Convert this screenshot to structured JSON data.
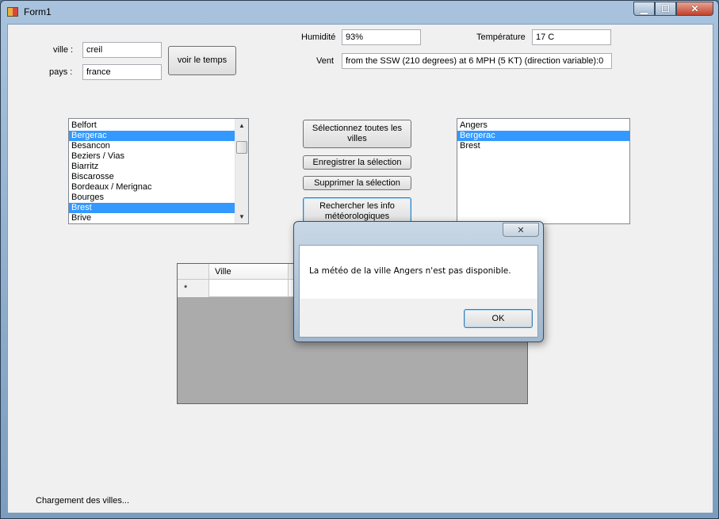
{
  "window": {
    "title": "Form1"
  },
  "form": {
    "ville_label": "ville :",
    "ville_value": "creil",
    "pays_label": "pays :",
    "pays_value": "france",
    "voir_button": "voir le temps",
    "humidite_label": "Humidité",
    "humidite_value": "93%",
    "temperature_label": "Température",
    "temperature_value": "17 C",
    "vent_label": "Vent",
    "vent_value": "from the SSW (210 degrees) at 6 MPH (5 KT) (direction variable):0"
  },
  "city_list": {
    "items": [
      {
        "label": "Belfort",
        "selected": false
      },
      {
        "label": "Bergerac",
        "selected": true
      },
      {
        "label": "Besancon",
        "selected": false
      },
      {
        "label": "Beziers / Vias",
        "selected": false
      },
      {
        "label": "Biarritz",
        "selected": false
      },
      {
        "label": "Biscarosse",
        "selected": false
      },
      {
        "label": "Bordeaux / Merignac",
        "selected": false
      },
      {
        "label": "Bourges",
        "selected": false
      },
      {
        "label": "Brest",
        "selected": true
      },
      {
        "label": "Brive",
        "selected": false
      }
    ]
  },
  "actions": {
    "select_all": "Sélectionnez toutes les villes",
    "save": "Enregistrer la sélection",
    "delete": "Supprimer la sélection",
    "search": "Rechercher les info météorologiques"
  },
  "selected_list": {
    "items": [
      {
        "label": "Angers",
        "selected": false
      },
      {
        "label": "Bergerac",
        "selected": true
      },
      {
        "label": "Brest",
        "selected": false
      }
    ]
  },
  "grid": {
    "column": "Ville",
    "new_row_marker": "*"
  },
  "dialog": {
    "message": "La météo de la ville Angers n'est pas disponible.",
    "ok": "OK"
  },
  "status": {
    "text": "Chargement des villes..."
  },
  "colors": {
    "selection": "#3399ff",
    "client_bg": "#f0f0f0",
    "grid_bg": "#ababab"
  }
}
